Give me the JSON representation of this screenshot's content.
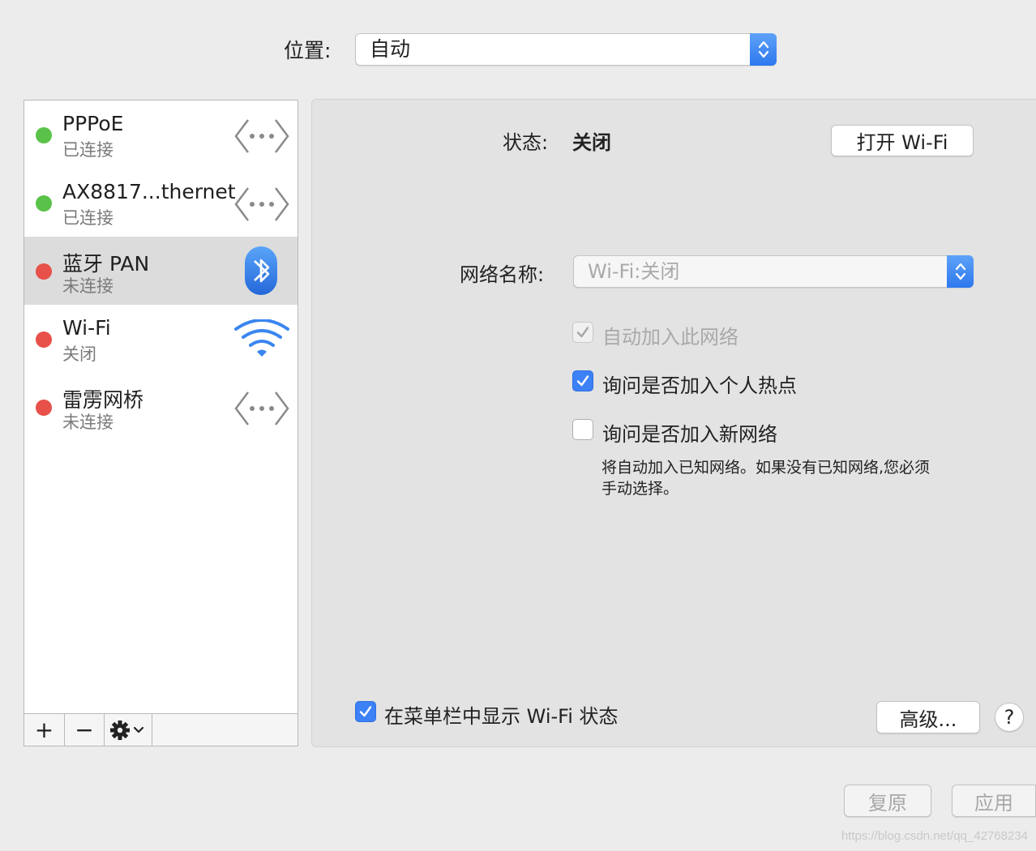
{
  "location": {
    "label": "位置:",
    "value": "自动"
  },
  "services": [
    {
      "name": "PPPoE",
      "status": "已连接",
      "dot_color": "#5ac249",
      "icon": "ellipsis-arrows-icon",
      "selected": false
    },
    {
      "name": "AX8817...thernet",
      "status": "已连接",
      "dot_color": "#5ac249",
      "icon": "ellipsis-arrows-icon",
      "selected": false
    },
    {
      "name": "蓝牙 PAN",
      "status": "未连接",
      "dot_color": "#e8504a",
      "icon": "bluetooth-icon",
      "selected": true
    },
    {
      "name": "Wi-Fi",
      "status": "关闭",
      "dot_color": "#e8504a",
      "icon": "wifi-icon",
      "selected": false
    },
    {
      "name": "雷雳网桥",
      "status": "未连接",
      "dot_color": "#e8504a",
      "icon": "ellipsis-arrows-icon",
      "selected": false
    }
  ],
  "toolbar": {
    "add": "+",
    "remove": "−"
  },
  "panel": {
    "status_label": "状态:",
    "status_value": "关闭",
    "wifi_button": "打开 Wi-Fi",
    "network_name_label": "网络名称:",
    "network_name_value": "Wi-Fi:关闭",
    "auto_join": {
      "label": "自动加入此网络",
      "checked": true,
      "enabled": false
    },
    "ask_hotspot": {
      "label": "询问是否加入个人热点",
      "checked": true
    },
    "ask_new": {
      "label": "询问是否加入新网络",
      "checked": false
    },
    "ask_new_desc_line1": "将自动加入已知网络。如果没有已知网络,您必须",
    "ask_new_desc_line2": "手动选择。",
    "show_menu_bar": {
      "label": "在菜单栏中显示 Wi-Fi 状态",
      "checked": true
    },
    "advanced_button": "高级...",
    "help_button": "?"
  },
  "footer": {
    "revert": "复原",
    "apply": "应用"
  },
  "watermark": "https://blog.csdn.net/qq_42768234",
  "colors": {
    "accent": "#3c81f6",
    "connected": "#5ac249",
    "disconnected": "#e8504a"
  }
}
